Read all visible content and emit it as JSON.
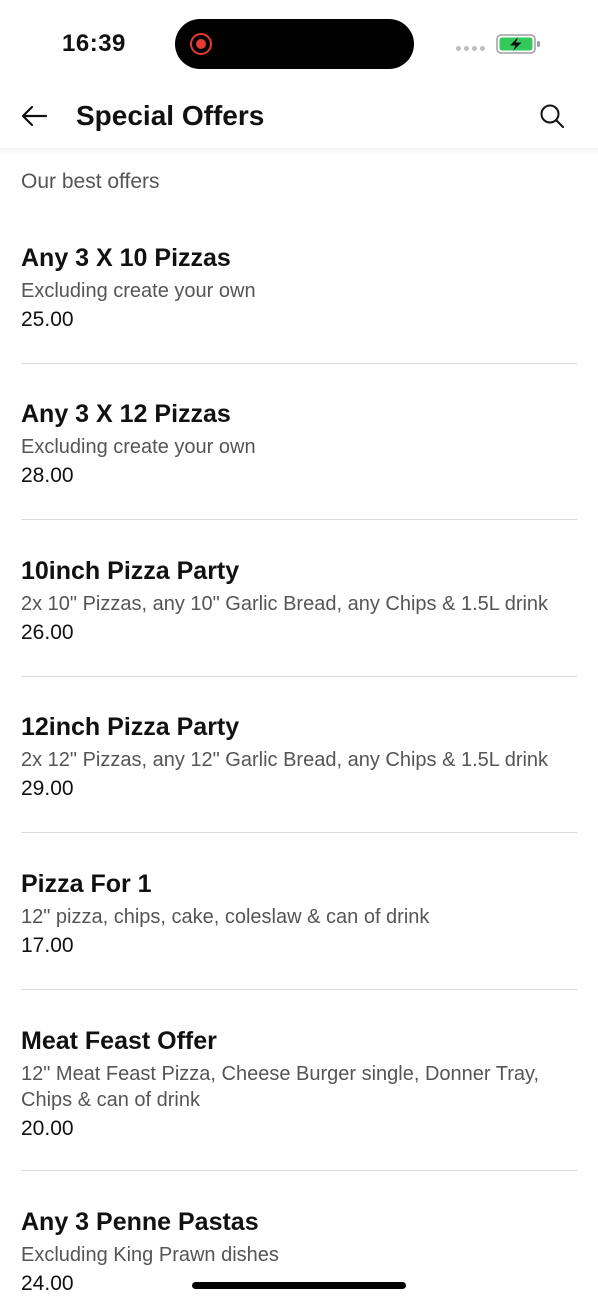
{
  "status_bar": {
    "time": "16:39",
    "record_color": "#e53935",
    "battery_color": "#34c759",
    "icons": [
      "record-icon",
      "signal-icon",
      "battery-charging-icon"
    ]
  },
  "header": {
    "title": "Special Offers",
    "back_icon": "arrow-left-icon",
    "search_icon": "search-icon"
  },
  "section_label": "Our best offers",
  "offers": [
    {
      "title": "Any 3 X 10 Pizzas",
      "description": "Excluding create your own",
      "price": "25.00"
    },
    {
      "title": "Any 3 X 12 Pizzas",
      "description": "Excluding create your own",
      "price": "28.00"
    },
    {
      "title": "10inch Pizza Party",
      "description": "2x 10\" Pizzas, any 10\" Garlic Bread, any Chips & 1.5L drink",
      "price": "26.00"
    },
    {
      "title": "12inch Pizza Party",
      "description": "2x 12\" Pizzas, any 12\" Garlic Bread, any Chips & 1.5L drink",
      "price": "29.00"
    },
    {
      "title": "Pizza For 1",
      "description": "12\" pizza, chips, cake, coleslaw & can of drink",
      "price": "17.00"
    },
    {
      "title": "Meat Feast Offer",
      "description": "12\" Meat Feast Pizza, Cheese Burger single, Donner Tray, Chips & can of drink",
      "price": "20.00"
    },
    {
      "title": "Any 3 Penne Pastas",
      "description": "Excluding King Prawn dishes",
      "price": "24.00"
    }
  ]
}
